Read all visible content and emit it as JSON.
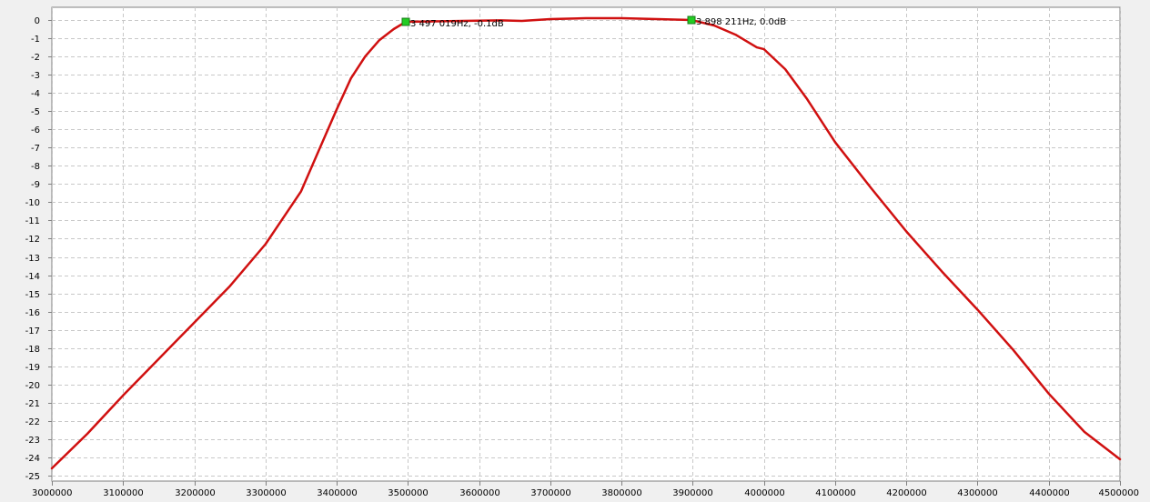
{
  "chart_data": {
    "type": "line",
    "title": "",
    "xlabel": "",
    "ylabel": "",
    "xlim": [
      3000000,
      4500000
    ],
    "ylim": [
      -25.3,
      0.7
    ],
    "grid": true,
    "x_ticks": [
      "3000000",
      "3100000",
      "3200000",
      "3300000",
      "3400000",
      "3500000",
      "3600000",
      "3700000",
      "3800000",
      "3900000",
      "4000000",
      "4100000",
      "4200000",
      "4300000",
      "4400000",
      "4500000"
    ],
    "y_ticks": [
      "0",
      "-1",
      "-2",
      "-3",
      "-4",
      "-5",
      "-6",
      "-7",
      "-8",
      "-9",
      "-10",
      "-11",
      "-12",
      "-13",
      "-14",
      "-15",
      "-16",
      "-17",
      "-18",
      "-19",
      "-20",
      "-21",
      "-22",
      "-23",
      "-24",
      "-25"
    ],
    "series": [
      {
        "color": "#d01010",
        "points": [
          [
            3000000,
            -24.6
          ],
          [
            3050000,
            -22.7
          ],
          [
            3100000,
            -20.6
          ],
          [
            3150000,
            -18.6
          ],
          [
            3200000,
            -16.6
          ],
          [
            3250000,
            -14.6
          ],
          [
            3300000,
            -12.3
          ],
          [
            3350000,
            -9.4
          ],
          [
            3380000,
            -6.7
          ],
          [
            3400000,
            -4.9
          ],
          [
            3420000,
            -3.2
          ],
          [
            3440000,
            -2.0
          ],
          [
            3460000,
            -1.1
          ],
          [
            3480000,
            -0.5
          ],
          [
            3497019,
            -0.1
          ],
          [
            3630000,
            -0.02
          ],
          [
            3660000,
            -0.05
          ],
          [
            3700000,
            0.05
          ],
          [
            3750000,
            0.1
          ],
          [
            3800000,
            0.1
          ],
          [
            3850000,
            0.05
          ],
          [
            3898211,
            0.0
          ],
          [
            3930000,
            -0.3
          ],
          [
            3960000,
            -0.8
          ],
          [
            3990000,
            -1.5
          ],
          [
            4000000,
            -1.6
          ],
          [
            4030000,
            -2.7
          ],
          [
            4060000,
            -4.3
          ],
          [
            4100000,
            -6.7
          ],
          [
            4150000,
            -9.2
          ],
          [
            4200000,
            -11.6
          ],
          [
            4250000,
            -13.8
          ],
          [
            4300000,
            -15.9
          ],
          [
            4350000,
            -18.1
          ],
          [
            4400000,
            -20.5
          ],
          [
            4450000,
            -22.6
          ],
          [
            4500000,
            -24.1
          ]
        ]
      }
    ],
    "markers": [
      {
        "x": 3497019,
        "y": -0.1,
        "label": "3 497 019Hz, -0.1dB",
        "color": "#22cc22"
      },
      {
        "x": 3898211,
        "y": 0.0,
        "label": "3 898 211Hz, 0.0dB",
        "color": "#22cc22"
      }
    ]
  }
}
